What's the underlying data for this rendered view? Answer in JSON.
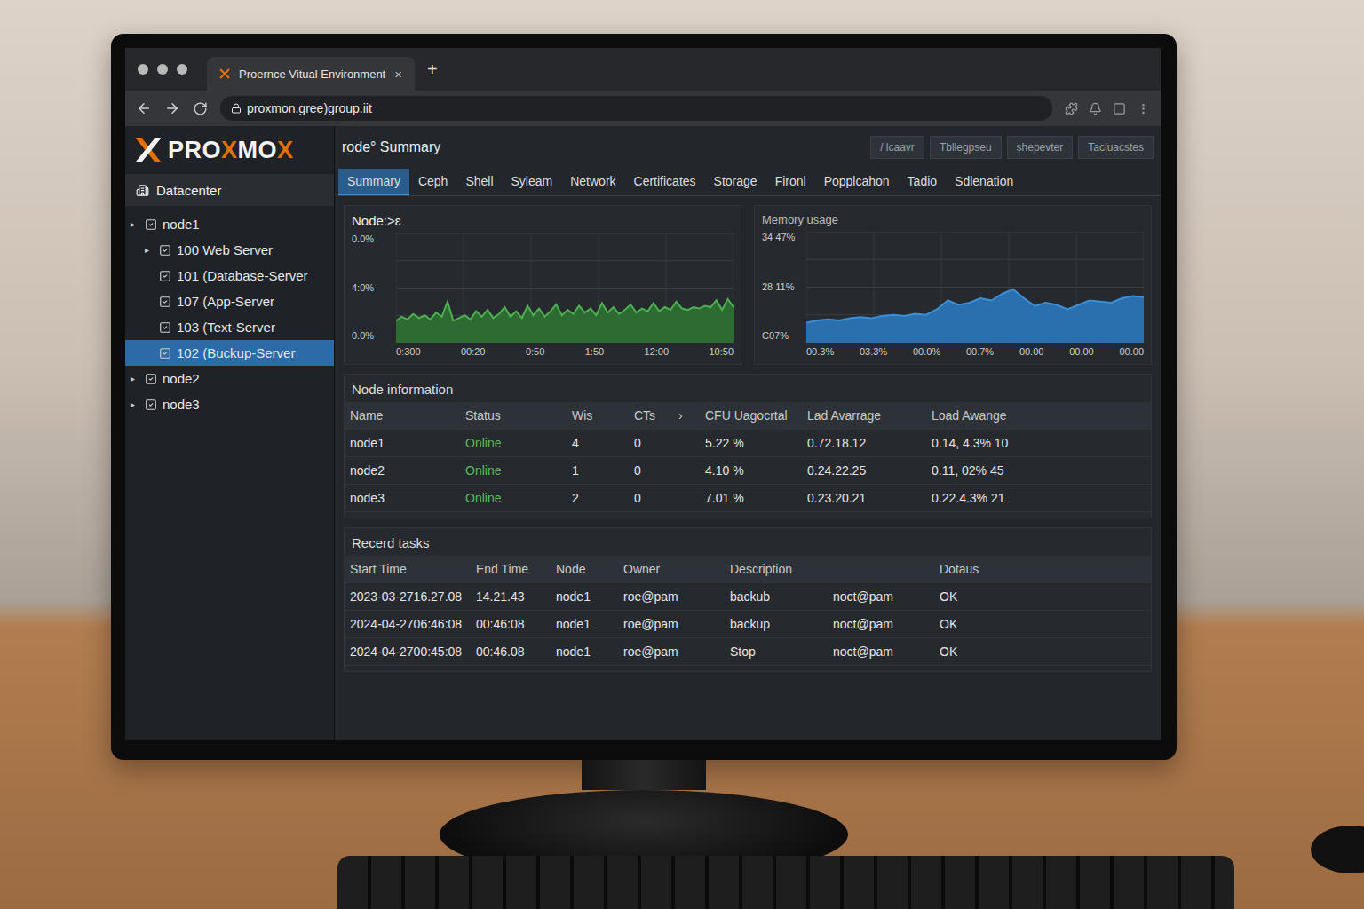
{
  "browser": {
    "tab_title": "Proernce Vitual Environment",
    "tab_close": "×",
    "new_tab": "+",
    "url": "proxmon.gree)group.iit"
  },
  "logo": [
    {
      "text": "PRO",
      "color": "#f2f2f2"
    },
    {
      "text": "X",
      "color": "#e57000"
    },
    {
      "text": "MO",
      "color": "#f2f2f2"
    },
    {
      "text": "X",
      "color": "#e57000"
    }
  ],
  "sidebar": {
    "root": "Datacenter",
    "items": [
      {
        "label": "node1",
        "kind": "node",
        "arrow": "▸",
        "selected": false
      },
      {
        "label": "100 Web Server",
        "kind": "vm",
        "arrow": "▸",
        "selected": false
      },
      {
        "label": "101 (Database-Server",
        "kind": "vm",
        "arrow": "",
        "selected": false
      },
      {
        "label": "107 (App-Server",
        "kind": "vm",
        "arrow": "",
        "selected": false
      },
      {
        "label": "103 (Text-Server",
        "kind": "vm",
        "arrow": "",
        "selected": false
      },
      {
        "label": "102 (Buckup-Server",
        "kind": "vm",
        "arrow": "",
        "selected": true
      },
      {
        "label": "node2",
        "kind": "node",
        "arrow": "▸",
        "selected": false
      },
      {
        "label": "node3",
        "kind": "node",
        "arrow": "▸",
        "selected": false
      }
    ]
  },
  "header": {
    "title": "rode° Summary",
    "buttons": [
      "/ lcaavr",
      "Tbllegpseu",
      "shepevter",
      "Tacluacstes"
    ]
  },
  "tabs": [
    {
      "label": "Summary",
      "selected": true
    },
    {
      "label": "Ceph",
      "selected": false
    },
    {
      "label": "Shell",
      "selected": false
    },
    {
      "label": "Syleam",
      "selected": false
    },
    {
      "label": "Network",
      "selected": false
    },
    {
      "label": "Certificates",
      "selected": false
    },
    {
      "label": "Storage",
      "selected": false
    },
    {
      "label": "Fironl",
      "selected": false
    },
    {
      "label": "Popplcahon",
      "selected": false
    },
    {
      "label": "Tadio",
      "selected": false
    },
    {
      "label": "Sdlenation",
      "selected": false
    }
  ],
  "cpu_chart": {
    "title": "Node:>ɛ",
    "y_ticks": [
      "0.0%",
      "4:0%",
      "0.0%"
    ],
    "x_ticks": [
      "0:300",
      "00:20",
      "0:50",
      "1:50",
      "12:00",
      "10:50"
    ],
    "y_max": 8,
    "values": [
      1.6,
      1.9,
      1.7,
      2.1,
      1.8,
      2.0,
      1.7,
      2.2,
      1.9,
      3.0,
      1.6,
      1.8,
      2.0,
      1.7,
      2.3,
      1.9,
      2.4,
      1.8,
      2.1,
      2.6,
      1.9,
      2.3,
      1.8,
      2.7,
      2.0,
      2.5,
      1.9,
      2.3,
      2.8,
      2.0,
      2.4,
      2.1,
      2.7,
      2.2,
      2.5,
      2.0,
      2.9,
      2.2,
      2.6,
      2.1,
      2.4,
      2.8,
      2.2,
      2.5,
      2.3,
      2.9,
      2.3,
      2.6,
      2.4,
      3.0,
      2.5,
      2.4,
      2.6,
      2.5,
      2.7,
      2.6,
      3.1,
      2.4,
      3.2,
      2.6
    ]
  },
  "memory_chart": {
    "title": "Memory usage",
    "y_ticks": [
      "34 47%",
      "28 11%",
      "C07%"
    ],
    "x_ticks": [
      "00.3%",
      "03.3%",
      "00.0%",
      "00.7%",
      "00.00",
      "00.00",
      "00.00"
    ],
    "y_max": 100,
    "values": [
      18,
      20,
      21,
      20,
      22,
      23,
      22,
      24,
      25,
      24,
      26,
      25,
      30,
      38,
      34,
      36,
      40,
      38,
      44,
      48,
      40,
      33,
      36,
      34,
      30,
      34,
      38,
      37,
      36,
      40,
      42,
      41
    ]
  },
  "node_table": {
    "title": "Node information",
    "columns": [
      "Name",
      "Status",
      "Wis",
      "CTs",
      "›",
      "CFU Uagocrtal",
      "Lad Avarrage",
      "Load Awange"
    ],
    "rows": [
      [
        "node1",
        "Online",
        "4",
        "0",
        "",
        "5.22 %",
        "0.72.18.12",
        "0.14, 4.3% 10"
      ],
      [
        "node2",
        "Online",
        "1",
        "0",
        "",
        "4.10 %",
        "0.24.22.25",
        "0.11, 02% 45"
      ],
      [
        "node3",
        "Online",
        "2",
        "0",
        "",
        "7.01 %",
        "0.23.20.21",
        "0.22.4.3% 21"
      ]
    ]
  },
  "tasks": {
    "title": "Recerd tasks",
    "columns": [
      "Start Time",
      "End Time",
      "Node",
      "Owner",
      "Description",
      "",
      "Dotaus"
    ],
    "rows": [
      [
        "2023-03-2716.27.08",
        "14.21.43",
        "node1",
        "roe@pam",
        "backub",
        "noct@pam",
        "OK"
      ],
      [
        "2024-04-2706:46:08",
        "00:46:08",
        "node1",
        "roe@pam",
        "backup",
        "noct@pam",
        "OK"
      ],
      [
        "2024-04-2700:45:08",
        "00:46.08",
        "node1",
        "roe@pam",
        "Stop",
        "noct@pam",
        "OK"
      ]
    ]
  }
}
